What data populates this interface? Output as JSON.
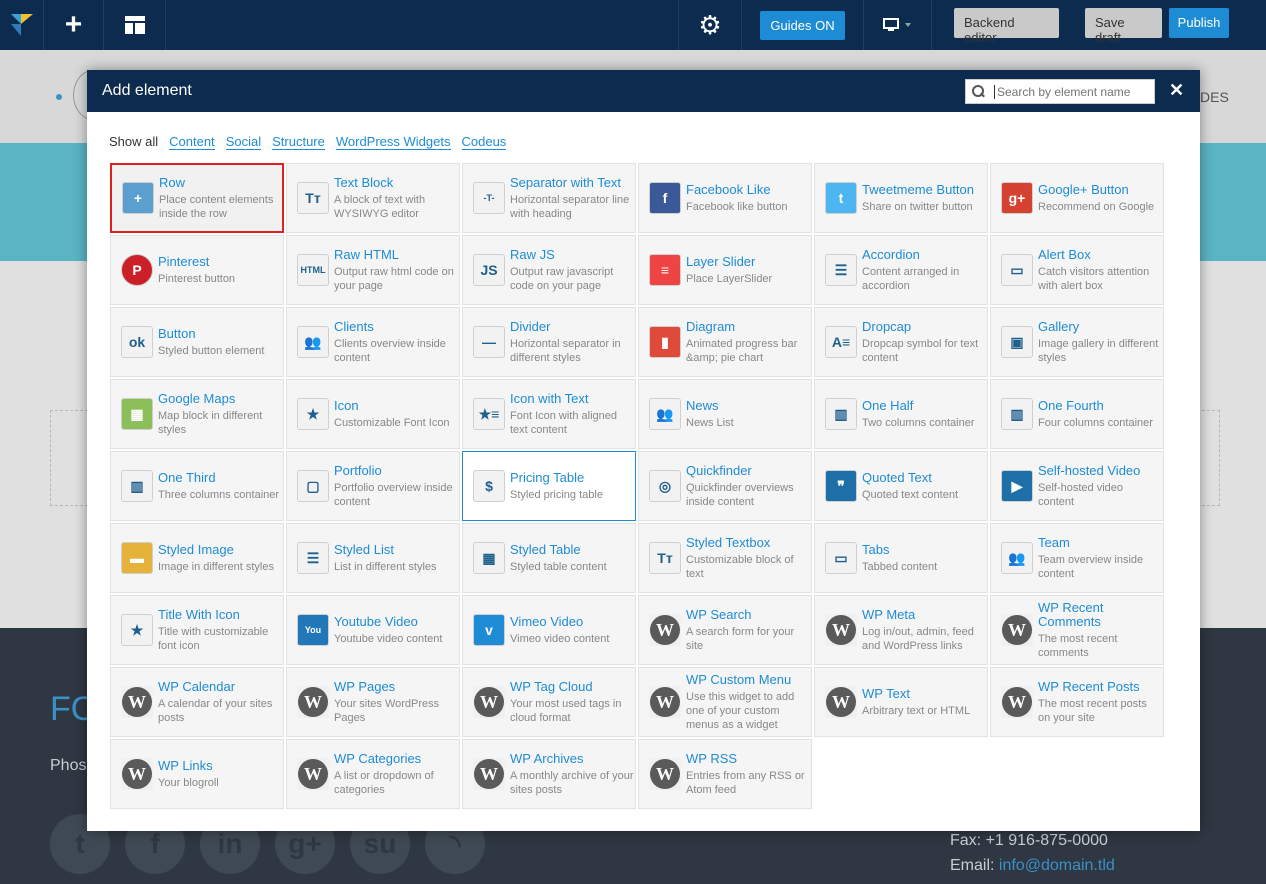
{
  "toolbar": {
    "guides_label": "Guides ON",
    "backend_label": "Backend editor",
    "draft_label": "Save draft",
    "publish_label": "Publish"
  },
  "page": {
    "header_partial": "DES",
    "footer_title_partial": "FO",
    "footer_phone_partial": "Phos",
    "fax": "Fax: +1 916-875-0000",
    "email_label": "Email: ",
    "email": "info@domain.tld"
  },
  "modal": {
    "title": "Add element",
    "search_placeholder": "Search by element name",
    "close_label": "✕",
    "filters": [
      "Show all",
      "Content",
      "Social",
      "Structure",
      "WordPress Widgets",
      "Codeus"
    ],
    "elements": [
      {
        "title": "Row",
        "desc": "Place content elements inside the row",
        "icon": "row-icon",
        "glyph": "+"
      },
      {
        "title": "Text Block",
        "desc": "A block of text with WYSIWYG editor",
        "icon": "text-block-icon",
        "glyph": "Tт"
      },
      {
        "title": "Separator with Text",
        "desc": "Horizontal separator line with heading",
        "icon": "separator-text-icon",
        "glyph": "-T-"
      },
      {
        "title": "Facebook Like",
        "desc": "Facebook like button",
        "icon": "facebook-icon",
        "glyph": "f"
      },
      {
        "title": "Tweetmeme Button",
        "desc": "Share on twitter button",
        "icon": "twitter-icon",
        "glyph": "t"
      },
      {
        "title": "Google+ Button",
        "desc": "Recommend on Google",
        "icon": "google-plus-icon",
        "glyph": "g+"
      },
      {
        "title": "Pinterest",
        "desc": "Pinterest button",
        "icon": "pinterest-icon",
        "glyph": "P"
      },
      {
        "title": "Raw HTML",
        "desc": "Output raw html code on your page",
        "icon": "raw-html-icon",
        "glyph": "HTML"
      },
      {
        "title": "Raw JS",
        "desc": "Output raw javascript code on your page",
        "icon": "raw-js-icon",
        "glyph": "JS"
      },
      {
        "title": "Layer Slider",
        "desc": "Place LayerSlider",
        "icon": "layer-slider-icon",
        "glyph": "≡"
      },
      {
        "title": "Accordion",
        "desc": "Content arranged in accordion",
        "icon": "accordion-icon",
        "glyph": "☰"
      },
      {
        "title": "Alert Box",
        "desc": "Catch visitors attention with alert box",
        "icon": "alert-box-icon",
        "glyph": "▭"
      },
      {
        "title": "Button",
        "desc": "Styled button element",
        "icon": "button-icon",
        "glyph": "ok"
      },
      {
        "title": "Clients",
        "desc": "Clients overview inside content",
        "icon": "clients-icon",
        "glyph": "👥"
      },
      {
        "title": "Divider",
        "desc": "Horizontal separator in different styles",
        "icon": "divider-icon",
        "glyph": "—"
      },
      {
        "title": "Diagram",
        "desc": "Animated progress bar &amp; pie chart",
        "icon": "diagram-icon",
        "glyph": "▮"
      },
      {
        "title": "Dropcap",
        "desc": "Dropcap symbol for text content",
        "icon": "dropcap-icon",
        "glyph": "A≡"
      },
      {
        "title": "Gallery",
        "desc": "Image gallery in different styles",
        "icon": "gallery-icon",
        "glyph": "▣"
      },
      {
        "title": "Google Maps",
        "desc": "Map block in different styles",
        "icon": "map-icon",
        "glyph": "▦"
      },
      {
        "title": "Icon",
        "desc": "Customizable Font Icon",
        "icon": "star-icon",
        "glyph": "★"
      },
      {
        "title": "Icon with Text",
        "desc": "Font Icon with aligned text content",
        "icon": "icon-with-text-icon",
        "glyph": "★≡"
      },
      {
        "title": "News",
        "desc": "News List",
        "icon": "news-icon",
        "glyph": "👥"
      },
      {
        "title": "One Half",
        "desc": "Two columns container",
        "icon": "one-half-icon",
        "glyph": "▥"
      },
      {
        "title": "One Fourth",
        "desc": "Four columns container",
        "icon": "one-fourth-icon",
        "glyph": "▥"
      },
      {
        "title": "One Third",
        "desc": "Three columns container",
        "icon": "one-third-icon",
        "glyph": "▥"
      },
      {
        "title": "Portfolio",
        "desc": "Portfolio overview inside content",
        "icon": "portfolio-icon",
        "glyph": "▢"
      },
      {
        "title": "Pricing Table",
        "desc": "Styled pricing table",
        "icon": "pricing-table-icon",
        "glyph": "$"
      },
      {
        "title": "Quickfinder",
        "desc": "Quickfinder overviews inside content",
        "icon": "quickfinder-icon",
        "glyph": "◎"
      },
      {
        "title": "Quoted Text",
        "desc": "Quoted text content",
        "icon": "quote-icon",
        "glyph": "❞"
      },
      {
        "title": "Self-hosted Video",
        "desc": "Self-hosted video content",
        "icon": "video-icon",
        "glyph": "▶"
      },
      {
        "title": "Styled Image",
        "desc": "Image in different styles",
        "icon": "image-icon",
        "glyph": "▬"
      },
      {
        "title": "Styled List",
        "desc": "List in different styles",
        "icon": "list-icon",
        "glyph": "☰"
      },
      {
        "title": "Styled Table",
        "desc": "Styled table content",
        "icon": "table-icon",
        "glyph": "▦"
      },
      {
        "title": "Styled Textbox",
        "desc": "Customizable block of text",
        "icon": "textbox-icon",
        "glyph": "Tт"
      },
      {
        "title": "Tabs",
        "desc": "Tabbed content",
        "icon": "tabs-icon",
        "glyph": "▭"
      },
      {
        "title": "Team",
        "desc": "Team overview inside content",
        "icon": "team-icon",
        "glyph": "👥"
      },
      {
        "title": "Title With Icon",
        "desc": "Title with customizable font icon",
        "icon": "title-icon-icon",
        "glyph": "★"
      },
      {
        "title": "Youtube Video",
        "desc": "Youtube video content",
        "icon": "youtube-icon",
        "glyph": "You"
      },
      {
        "title": "Vimeo Video",
        "desc": "Vimeo video content",
        "icon": "vimeo-icon",
        "glyph": "v"
      },
      {
        "title": "WP Search",
        "desc": "A search form for your site",
        "icon": "wordpress-icon",
        "glyph": "W"
      },
      {
        "title": "WP Meta",
        "desc": "Log in/out, admin, feed and WordPress links",
        "icon": "wordpress-icon",
        "glyph": "W"
      },
      {
        "title": "WP Recent Comments",
        "desc": "The most recent comments",
        "icon": "wordpress-icon",
        "glyph": "W"
      },
      {
        "title": "WP Calendar",
        "desc": "A calendar of your sites posts",
        "icon": "wordpress-icon",
        "glyph": "W"
      },
      {
        "title": "WP Pages",
        "desc": "Your sites WordPress Pages",
        "icon": "wordpress-icon",
        "glyph": "W"
      },
      {
        "title": "WP Tag Cloud",
        "desc": "Your most used tags in cloud format",
        "icon": "wordpress-icon",
        "glyph": "W"
      },
      {
        "title": "WP Custom Menu",
        "desc": "Use this widget to add one of your custom menus as a widget",
        "icon": "wordpress-icon",
        "glyph": "W"
      },
      {
        "title": "WP Text",
        "desc": "Arbitrary text or HTML",
        "icon": "wordpress-icon",
        "glyph": "W"
      },
      {
        "title": "WP Recent Posts",
        "desc": "The most recent posts on your site",
        "icon": "wordpress-icon",
        "glyph": "W"
      },
      {
        "title": "WP Links",
        "desc": "Your blogroll",
        "icon": "wordpress-icon",
        "glyph": "W"
      },
      {
        "title": "WP Categories",
        "desc": "A list or dropdown of categories",
        "icon": "wordpress-icon",
        "glyph": "W"
      },
      {
        "title": "WP Archives",
        "desc": "A monthly archive of your sites posts",
        "icon": "wordpress-icon",
        "glyph": "W"
      },
      {
        "title": "WP RSS",
        "desc": "Entries from any RSS or Atom feed",
        "icon": "wordpress-icon",
        "glyph": "W"
      }
    ]
  },
  "colors": {
    "toolbar_bg": "#0c2b4e",
    "accent": "#1e8cd5",
    "selected_border": "#e02020"
  }
}
